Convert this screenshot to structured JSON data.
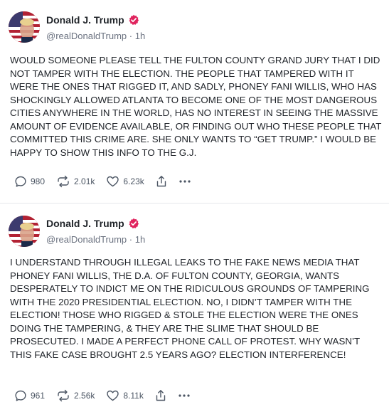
{
  "posts": [
    {
      "display_name": "Donald J. Trump",
      "handle": "@realDonaldTrump",
      "separator": "·",
      "time": "1h",
      "text": "WOULD SOMEONE PLEASE TELL THE FULTON COUNTY GRAND JURY THAT I DID NOT TAMPER WITH THE ELECTION. THE PEOPLE THAT TAMPERED WITH IT WERE THE ONES THAT RIGGED IT, AND SADLY, PHONEY FANI WILLIS, WHO HAS SHOCKINGLY ALLOWED ATLANTA TO BECOME ONE OF THE MOST DANGEROUS CITIES ANYWHERE IN THE WORLD, HAS NO INTEREST IN SEEING THE MASSIVE AMOUNT OF EVIDENCE AVAILABLE, OR FINDING OUT WHO THESE PEOPLE THAT COMMITTED THIS CRIME ARE. SHE ONLY WANTS TO “GET TRUMP.” I WOULD BE HAPPY TO SHOW THIS INFO TO THE G.J.",
      "replies": "980",
      "retruths": "2.01k",
      "likes": "6.23k"
    },
    {
      "display_name": "Donald J. Trump",
      "handle": "@realDonaldTrump",
      "separator": "·",
      "time": "1h",
      "text": "I UNDERSTAND THROUGH ILLEGAL LEAKS TO THE FAKE NEWS MEDIA THAT PHONEY FANI WILLIS, THE D.A. OF FULTON COUNTY, GEORGIA, WANTS DESPERATELY TO INDICT ME ON THE RIDICULOUS GROUNDS OF TAMPERING WITH THE 2020 PRESIDENTIAL ELECTION. NO, I DIDN’T TAMPER WITH THE ELECTION! THOSE WHO RIGGED & STOLE THE ELECTION WERE THE ONES DOING THE TAMPERING, & THEY ARE THE SLIME THAT SHOULD BE PROSECUTED. I MADE A PERFECT PHONE CALL OF PROTEST. WHY WASN’T THIS FAKE CASE BROUGHT 2.5 YEARS AGO? ELECTION INTERFERENCE!",
      "replies": "961",
      "retruths": "2.56k",
      "likes": "8.11k"
    }
  ],
  "icons": {
    "verified": "verified-badge-icon",
    "reply": "reply-icon",
    "retruth": "retruth-icon",
    "like": "heart-icon",
    "share": "share-icon",
    "more": "more-icon"
  },
  "colors": {
    "verified_badge": "#e0245e",
    "text": "#20242a",
    "muted": "#6b7280",
    "divider": "#e6e8eb"
  }
}
